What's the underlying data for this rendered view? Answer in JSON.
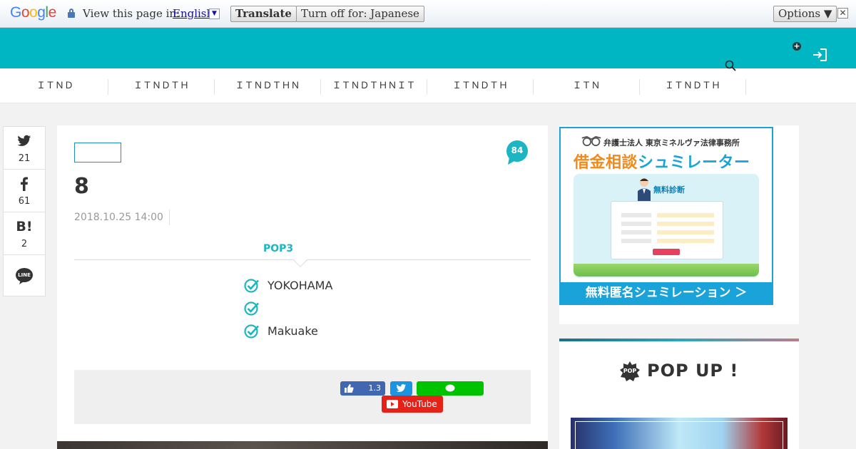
{
  "translate_bar": {
    "logo": "Google",
    "logo_colors": [
      "#4285f4",
      "#ea4335",
      "#fbbc05",
      "#4285f4",
      "#34a853",
      "#ea4335"
    ],
    "prompt": "View this page in:",
    "language": "English",
    "translate_label": "Translate",
    "turn_off_label": "Turn off for: Japanese",
    "options_label": "Options ▼",
    "close_glyph": "✕"
  },
  "header": {
    "accent_color": "#01b6c3"
  },
  "nav": {
    "items": [
      "ＩＴＮＤ",
      "ＩＴＮＤＴＨ",
      "ＩＴＮＤＴＨＮ",
      "ＩＴＮＤＴＨＮＩＴ",
      "ＩＴＮＤＴＨ",
      "ＩＴＮ",
      "ＩＴＮＤＴＨ"
    ]
  },
  "share_sidebar": {
    "twitter": {
      "icon": "twitter-icon",
      "count": "21"
    },
    "facebook": {
      "icon": "facebook-icon",
      "count": "61"
    },
    "hatena": {
      "icon": "hatena-icon",
      "label": "B!",
      "count": "2"
    },
    "line": {
      "icon": "line-icon",
      "label": "LINE"
    }
  },
  "article": {
    "comment_count": "84",
    "title": "8",
    "date": "2018.10.25 14:00",
    "pop_heading": "POP3",
    "checklist": [
      "YOKOHAMA",
      "",
      "Makuake"
    ],
    "social": {
      "fb_count": "1.3",
      "youtube_label": "YouTube"
    }
  },
  "sidebar": {
    "ad": {
      "firm": "弁護士法人 東京ミネルヴァ法律事務所",
      "headline_a": "借金相談",
      "headline_b": "シュミレーター",
      "diagnosis": "無料診断",
      "footer": "無料匿名シュミレーション ＞"
    },
    "popup": {
      "badge": "POP",
      "title": "POP UP !"
    }
  }
}
